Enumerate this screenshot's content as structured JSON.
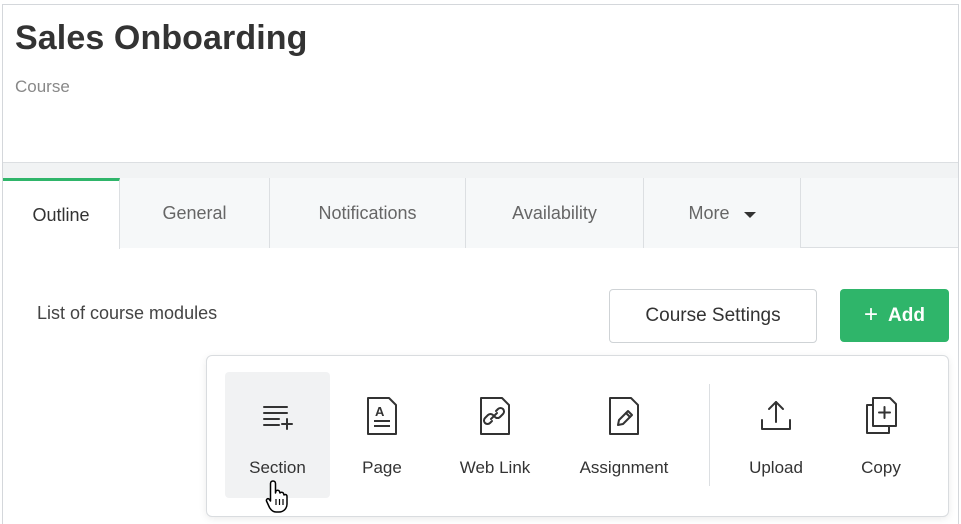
{
  "header": {
    "title": "Sales Onboarding",
    "subtitle": "Course"
  },
  "tabs": [
    {
      "label": "Outline",
      "active": true
    },
    {
      "label": "General",
      "active": false
    },
    {
      "label": "Notifications",
      "active": false
    },
    {
      "label": "Availability",
      "active": false
    },
    {
      "label": "More",
      "active": false,
      "has_dropdown": true
    }
  ],
  "content": {
    "list_label": "List of course modules",
    "course_settings_label": "Course Settings",
    "add_label": "Add"
  },
  "add_menu": {
    "items": [
      {
        "label": "Section",
        "icon": "section-icon",
        "hovered": true
      },
      {
        "label": "Page",
        "icon": "page-icon"
      },
      {
        "label": "Web Link",
        "icon": "web-link-icon"
      },
      {
        "label": "Assignment",
        "icon": "assignment-icon"
      },
      {
        "label": "Upload",
        "icon": "upload-icon"
      },
      {
        "label": "Copy",
        "icon": "copy-icon"
      }
    ]
  },
  "colors": {
    "accent": "#2fb56a",
    "tab_bg": "#f6f8f9",
    "border": "#dcdfe2",
    "hover_bg": "#f1f2f3"
  }
}
